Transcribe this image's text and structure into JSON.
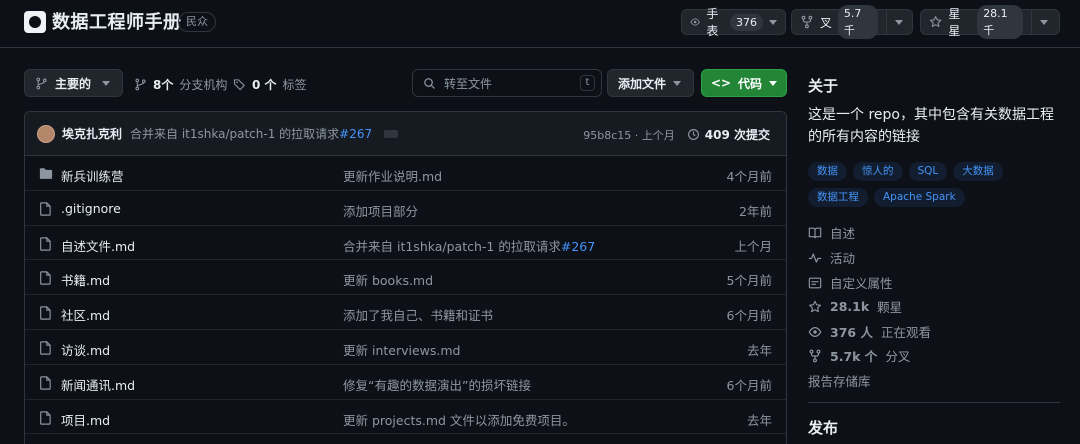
{
  "repo": {
    "title": "数据工程师手册",
    "visibility": "民众"
  },
  "header_actions": {
    "watch": {
      "label": "手表",
      "count": "376"
    },
    "fork": {
      "label": "叉",
      "count": "5.7千"
    },
    "star": {
      "label": "星星",
      "count": "28.1千"
    }
  },
  "toolbar": {
    "branch": "主要的",
    "branches_count": "8个",
    "branches_label": "分支机构",
    "tags_count": "0 个",
    "tags_label": "标签",
    "search_placeholder": "转至文件",
    "search_kbd": "t",
    "add_file": "添加文件",
    "code": "代码"
  },
  "latest_commit": {
    "author": "埃克扎克利",
    "message": "合并来自 it1shka/patch-1 的拉取请求",
    "pr": "#267",
    "hash_time": "95b8c15 · 上个月",
    "commits": "409 次提交"
  },
  "files": [
    {
      "icon": "folder-icon",
      "name": "新兵训练营",
      "message": "更新作业说明.md",
      "pr": "",
      "time": "4个月前"
    },
    {
      "icon": "file-icon",
      "name": ".gitignore",
      "message": "添加项目部分",
      "pr": "",
      "time": "2年前"
    },
    {
      "icon": "file-icon",
      "name": "自述文件.md",
      "message": "合并来自 it1shka/patch-1 的拉取请求",
      "pr": "#267",
      "time": "上个月"
    },
    {
      "icon": "file-icon",
      "name": "书籍.md",
      "message": "更新 books.md",
      "pr": "",
      "time": "5个月前"
    },
    {
      "icon": "file-icon",
      "name": "社区.md",
      "message": "添加了我自己、书籍和证书",
      "pr": "",
      "time": "6个月前"
    },
    {
      "icon": "file-icon",
      "name": "访谈.md",
      "message": "更新 interviews.md",
      "pr": "",
      "time": "去年"
    },
    {
      "icon": "file-icon",
      "name": "新闻通讯.md",
      "message": "修复“有趣的数据演出”的损坏链接",
      "pr": "",
      "time": "6个月前"
    },
    {
      "icon": "file-icon",
      "name": "项目.md",
      "message": "更新 projects.md 文件以添加免费项目。",
      "pr": "",
      "time": "去年"
    }
  ],
  "sidebar": {
    "about_heading": "关于",
    "description": "这是一个 repo，其中包含有关数据工程的所有内容的链接",
    "topics": [
      "数据",
      "惊人的",
      "SQL",
      "大数据",
      "数据工程",
      "Apache Spark"
    ],
    "readme": "自述",
    "activity": "活动",
    "custom_properties": "自定义属性",
    "stars_count": "28.1k",
    "stars_label": "颗星",
    "watchers_count": "376 人",
    "watchers_label": "正在观看",
    "forks_count": "5.7k 个",
    "forks_label": "分叉",
    "report": "报告存储库",
    "releases_heading": "发布"
  },
  "colors": {
    "accent": "#4493f8",
    "primary_button": "#238636",
    "background": "#0d1117"
  }
}
